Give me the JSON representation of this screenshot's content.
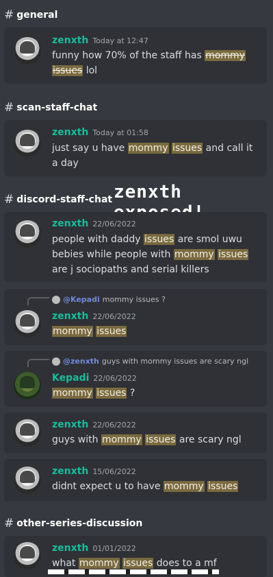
{
  "watermark": "zenxth exposed!",
  "channels": [
    "general",
    "scan-staff-chat",
    "discord-staff-chat",
    "other-series-discussion"
  ],
  "messages": [
    {
      "author": "zenxth",
      "time": "Today at 12:47",
      "pre": "funny how 70% of the staff has ",
      "hl1": "mommy",
      "hl2": "issues",
      "post": " lol"
    },
    {
      "author": "zenxth",
      "time": "Today at 01:58",
      "pre": "just say u have ",
      "hl1": "mommy",
      "hl2": "issues",
      "post": " and call it a day"
    },
    {
      "author": "zenxth",
      "time": "22/06/2022",
      "pre": "people with daddy ",
      "hl1": "issues",
      "mid": " are smol uwu bebies while people with ",
      "hl2": "mommy",
      "hl3": "issues",
      "post": " are j sociopaths and serial killers"
    },
    {
      "reply_mention": "@Kepadi",
      "reply_text": "mommy issues ?",
      "author": "zenxth",
      "time": "22/06/2022",
      "hl1": "mommy",
      "hl2": "issues"
    },
    {
      "reply_mention": "@zenxth",
      "reply_text": "guys with mommy issues are scary ngl",
      "author": "Kepadi",
      "time": "22/06/2022",
      "hl1": "mommy",
      "hl2": "issues",
      "post": " ?"
    },
    {
      "author": "zenxth",
      "time": "22/06/2022",
      "pre": "guys with ",
      "hl1": "mommy",
      "hl2": "issues",
      "post": " are scary ngl"
    },
    {
      "author": "zenxth",
      "time": "15/06/2022",
      "pre": "didnt expect u to have ",
      "hl1": "mommy",
      "hl2": "issues"
    },
    {
      "author": "zenxth",
      "time": "01/01/2022",
      "pre": "what ",
      "hl1": "mommy",
      "hl2": "issues",
      "post": " does to a mf"
    }
  ]
}
